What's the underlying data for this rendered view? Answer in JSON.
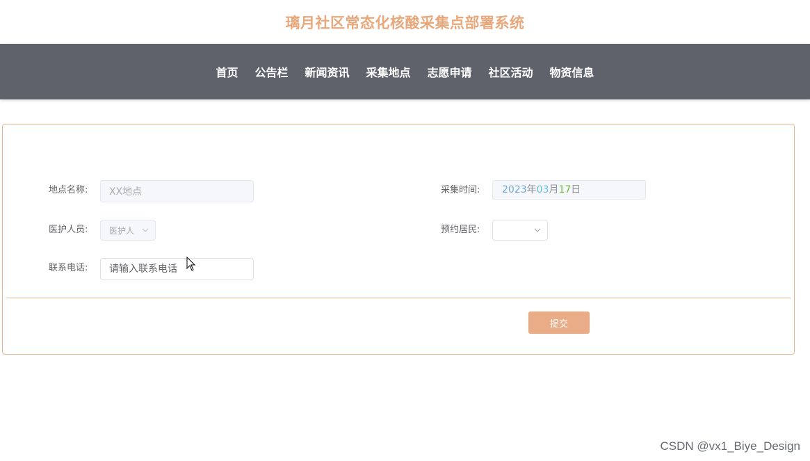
{
  "header": {
    "title": "璃月社区常态化核酸采集点部署系统",
    "title_color": "#e8a87c"
  },
  "nav": {
    "background": "#5e626b",
    "items": [
      {
        "label": "首页"
      },
      {
        "label": "公告栏"
      },
      {
        "label": "新闻资讯"
      },
      {
        "label": "采集地点"
      },
      {
        "label": "志愿申请"
      },
      {
        "label": "社区活动"
      },
      {
        "label": "物资信息"
      }
    ]
  },
  "form": {
    "location": {
      "label": "地点名称:",
      "value": "XX地点"
    },
    "collect_time": {
      "label": "采集时间:",
      "year": "2023",
      "year_unit": "年",
      "month": "03",
      "month_unit": "月",
      "day": "17",
      "day_unit": "日"
    },
    "medic": {
      "label": "医护人员:",
      "value": "医护人"
    },
    "resident": {
      "label": "预约居民:",
      "value": ""
    },
    "phone": {
      "label": "联系电话:",
      "placeholder": "请输入联系电话"
    },
    "submit_label": "提交",
    "submit_color": "#eaab87",
    "border_color": "#e2b38e"
  },
  "watermark": "CSDN @vx1_Biye_Design"
}
